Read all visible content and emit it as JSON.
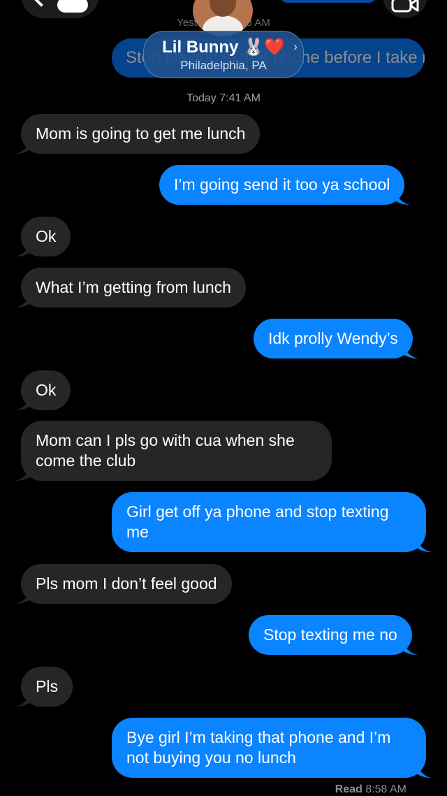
{
  "header": {
    "faded_timestamp": "Yesterday 10:43 AM",
    "faded_bubble_text": "Stop playing in that phone before I take it",
    "contact_name": "Lil Bunny 🐰❤️",
    "contact_location": "Philadelphia, PA",
    "contact_chevron": "›"
  },
  "thread": {
    "timestamp": "Today 7:41 AM",
    "messages": [
      {
        "dir": "received",
        "text": "Mom is going to get me lunch"
      },
      {
        "dir": "sent",
        "text": "I’m going send it too ya school"
      },
      {
        "dir": "received",
        "text": "Ok"
      },
      {
        "dir": "received",
        "text": "What I’m getting from lunch"
      },
      {
        "dir": "sent",
        "text": "Idk prolly Wendy’s"
      },
      {
        "dir": "received",
        "text": "Ok"
      },
      {
        "dir": "received",
        "text": "Mom can I pls go with cua when she come the club"
      },
      {
        "dir": "sent",
        "text": "Girl get off ya phone and stop texting me"
      },
      {
        "dir": "received",
        "text": "Pls mom I don’t feel good"
      },
      {
        "dir": "sent",
        "text": "Stop texting me no"
      },
      {
        "dir": "received",
        "text": "Pls"
      },
      {
        "dir": "sent",
        "text": "Bye girl I’m taking that phone and I’m not buying you no lunch"
      }
    ],
    "read_label": "Read",
    "read_time": "8:58 AM"
  },
  "colors": {
    "sent": "#0a84ff",
    "received": "#262629",
    "background": "#000000"
  },
  "icons": {
    "back": "chevron-left-icon",
    "video": "video-camera-icon"
  }
}
